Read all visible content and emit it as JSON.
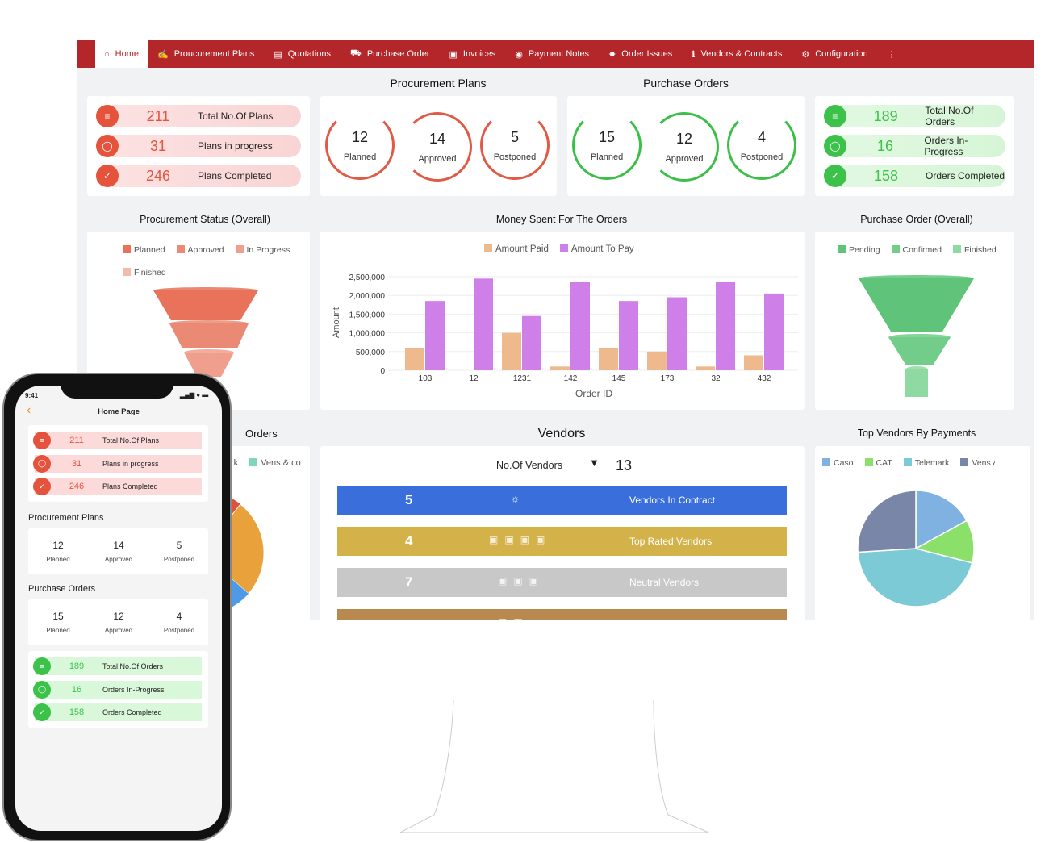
{
  "nav": {
    "items": [
      {
        "label": "Home",
        "icon": "home-icon"
      },
      {
        "label": "Proucurement Plans",
        "icon": "hand-icon"
      },
      {
        "label": "Quotations",
        "icon": "clipboard-icon"
      },
      {
        "label": "Purchase Order",
        "icon": "truck-icon"
      },
      {
        "label": "Invoices",
        "icon": "invoice-icon"
      },
      {
        "label": "Payment Notes",
        "icon": "money-icon"
      },
      {
        "label": "Order Issues",
        "icon": "bug-icon"
      },
      {
        "label": "Vendors & Contracts",
        "icon": "person-icon"
      },
      {
        "label": "Configuration",
        "icon": "gear-icon"
      }
    ],
    "more_icon": "vertical-dots-icon",
    "accent": "#b3262a"
  },
  "sections": {
    "procurement_plans": "Procurement Plans",
    "purchase_orders": "Purchase Orders",
    "procurement_status": "Procurement Status (Overall)",
    "money_spent": "Money Spent For The Orders",
    "purchase_order_overall": "Purchase Order (Overall)",
    "orders_partial": "Orders",
    "vendors": "Vendors",
    "top_vendors": "Top Vendors By Payments"
  },
  "plans_stats": [
    {
      "value": "211",
      "label": "Total No.Of Plans",
      "icon": "sliders-icon"
    },
    {
      "value": "31",
      "label": "Plans in progress",
      "icon": "progress-circle-icon"
    },
    {
      "value": "246",
      "label": "Plans Completed",
      "icon": "check-circle-icon"
    }
  ],
  "plans_rings": [
    {
      "value": "12",
      "label": "Planned"
    },
    {
      "value": "14",
      "label": "Approved"
    },
    {
      "value": "5",
      "label": "Postponed"
    }
  ],
  "orders_rings": [
    {
      "value": "15",
      "label": "Planned"
    },
    {
      "value": "12",
      "label": "Approved"
    },
    {
      "value": "4",
      "label": "Postponed"
    }
  ],
  "orders_stats": [
    {
      "value": "189",
      "label": "Total No.Of Orders",
      "icon": "sliders-icon"
    },
    {
      "value": "16",
      "label": "Orders In-Progress",
      "icon": "progress-circle-icon"
    },
    {
      "value": "158",
      "label": "Orders Completed",
      "icon": "check-circle-icon"
    }
  ],
  "colors": {
    "red": "#e5533d",
    "green": "#3cc24a",
    "blue": "#3a6fdb",
    "gold": "#d4b24a",
    "gray": "#c8c8c8",
    "brown": "#b88a50"
  },
  "procurement_funnel": {
    "legend": [
      "Planned",
      "Approved",
      "In Progress",
      "Finished"
    ],
    "colors": [
      "#e8735a",
      "#eb8a74",
      "#ef9f8c",
      "#f3b9ab"
    ]
  },
  "po_funnel": {
    "legend": [
      "Pending",
      "Confirmed",
      "Finished"
    ],
    "colors": [
      "#5fc47a",
      "#72cd8a",
      "#8fd9a3"
    ]
  },
  "orders_partial_legend": [
    "rk",
    "Vens & co"
  ],
  "vendors": {
    "count_label": "No.Of Vendors",
    "count_icon": "tie-icon",
    "count": "13",
    "rows": [
      {
        "value": "5",
        "icon": "handshake-icon",
        "label": "Vendors In Contract",
        "color": "#3a6fdb"
      },
      {
        "value": "4",
        "icon": "star-icon",
        "stars": 4,
        "label": "Top Rated Vendors",
        "color": "#d4b24a"
      },
      {
        "value": "7",
        "icon": "star-icon",
        "stars": 3,
        "label": "Neutral Vendors",
        "color": "#c8c8c8"
      },
      {
        "value": "",
        "icon": "star-icon",
        "stars": 2,
        "label": "",
        "color": "#b88a50"
      }
    ]
  },
  "chart_data": [
    {
      "type": "bar",
      "title": "Money Spent For The Orders",
      "xlabel": "Order ID",
      "ylabel": "Amount",
      "categories": [
        "103",
        "12",
        "1231",
        "142",
        "145",
        "173",
        "32",
        "432"
      ],
      "series": [
        {
          "name": "Amount Paid",
          "color": "#efb98e",
          "values": [
            600000,
            0,
            1000000,
            100000,
            600000,
            500000,
            100000,
            400000
          ]
        },
        {
          "name": "Amount To Pay",
          "color": "#cf7fe8",
          "values": [
            1850000,
            2450000,
            1450000,
            2350000,
            1850000,
            1950000,
            2350000,
            2050000
          ]
        }
      ],
      "yticks": [
        "0",
        "500,000",
        "1,000,000",
        "1,500,000",
        "2,000,000",
        "2,500,000"
      ],
      "ylim": [
        0,
        2500000
      ],
      "grid": true,
      "legend": "top"
    },
    {
      "type": "pie",
      "title": "Top Vendors By Payments",
      "labels": [
        "Caso",
        "CAT",
        "Telemark",
        "Vens &"
      ],
      "values": [
        17,
        12,
        45,
        26
      ],
      "colors": [
        "#7fb2e0",
        "#8be06a",
        "#7ccad6",
        "#7a86a8"
      ],
      "legend": "top"
    }
  ],
  "phone": {
    "time": "9:41",
    "title": "Home Page",
    "back_icon": "chevron-left-icon",
    "plans_title": "Procurement Plans",
    "orders_title": "Purchase Orders"
  }
}
